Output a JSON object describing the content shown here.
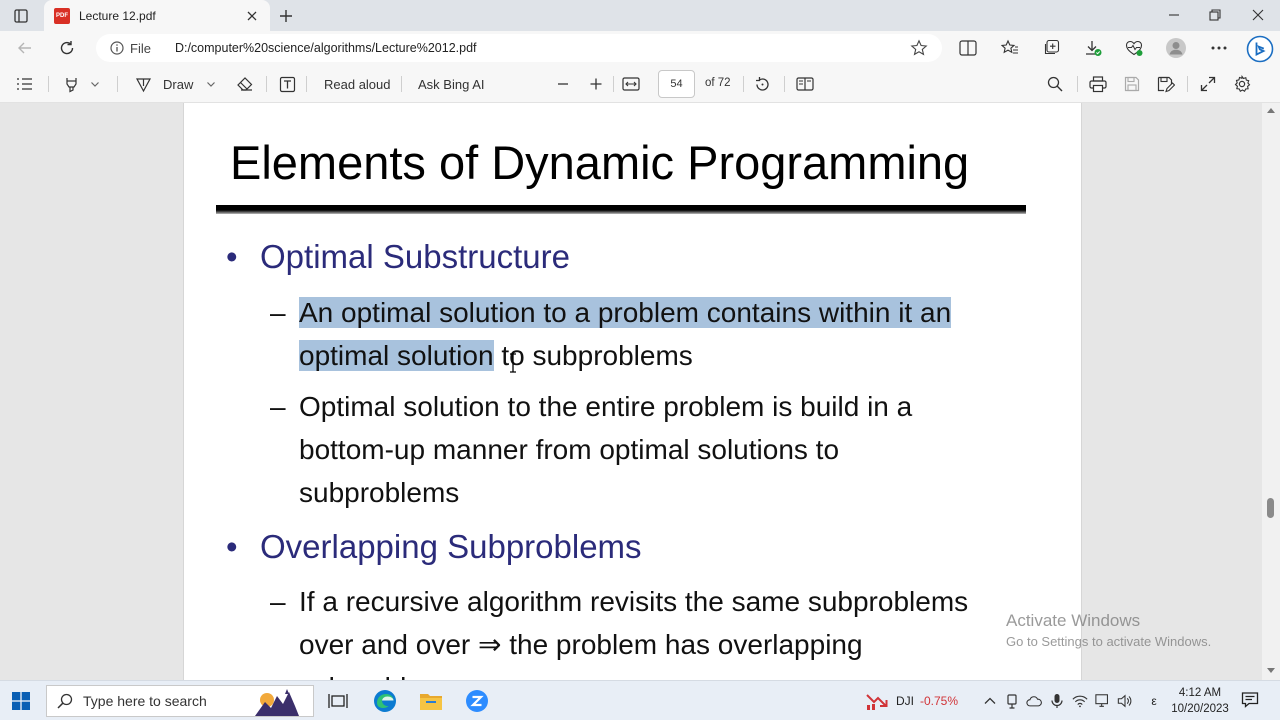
{
  "tab": {
    "title": "Lecture 12.pdf",
    "favicon_text": "PDF"
  },
  "address": {
    "file_label": "File",
    "url": "D:/computer%20science/algorithms/Lecture%2012.pdf"
  },
  "pdf_toolbar": {
    "draw_label": "Draw",
    "read_aloud_label": "Read aloud",
    "ask_ai_label": "Ask Bing AI",
    "current_page": "54",
    "page_count_text": "of 72"
  },
  "slide": {
    "title": "Elements of Dynamic Programming",
    "bullet_char": "•",
    "dash_char": "–",
    "bullets": [
      {
        "text": "Optimal Substructure",
        "subs": [
          {
            "line1_highlight": "An optimal solution to a problem contains within it an",
            "line2_highlight": "optimal solution",
            "line2_rest": " to subproblems"
          },
          {
            "lines": [
              "Optimal solution to the entire problem is build in a",
              "bottom-up manner from optimal solutions to",
              "subproblems"
            ]
          }
        ]
      },
      {
        "text": "Overlapping Subproblems",
        "subs": [
          {
            "lines": [
              "If a recursive algorithm revisits the same subproblems",
              "over and over ⇒ the problem has overlapping",
              "subproblems"
            ]
          }
        ]
      }
    ]
  },
  "watermark": {
    "line1": "Activate Windows",
    "line2": "Go to Settings to activate Windows."
  },
  "taskbar": {
    "search_placeholder": "Type here to search",
    "stock_name": "DJI",
    "stock_change": "-0.75%",
    "ime_char": "ε",
    "time": "4:12 AM",
    "date": "10/20/2023"
  },
  "colors": {
    "bullet_blue": "#2b2b7a",
    "selection": "#a8c2dd",
    "stock_down": "#d13438"
  }
}
